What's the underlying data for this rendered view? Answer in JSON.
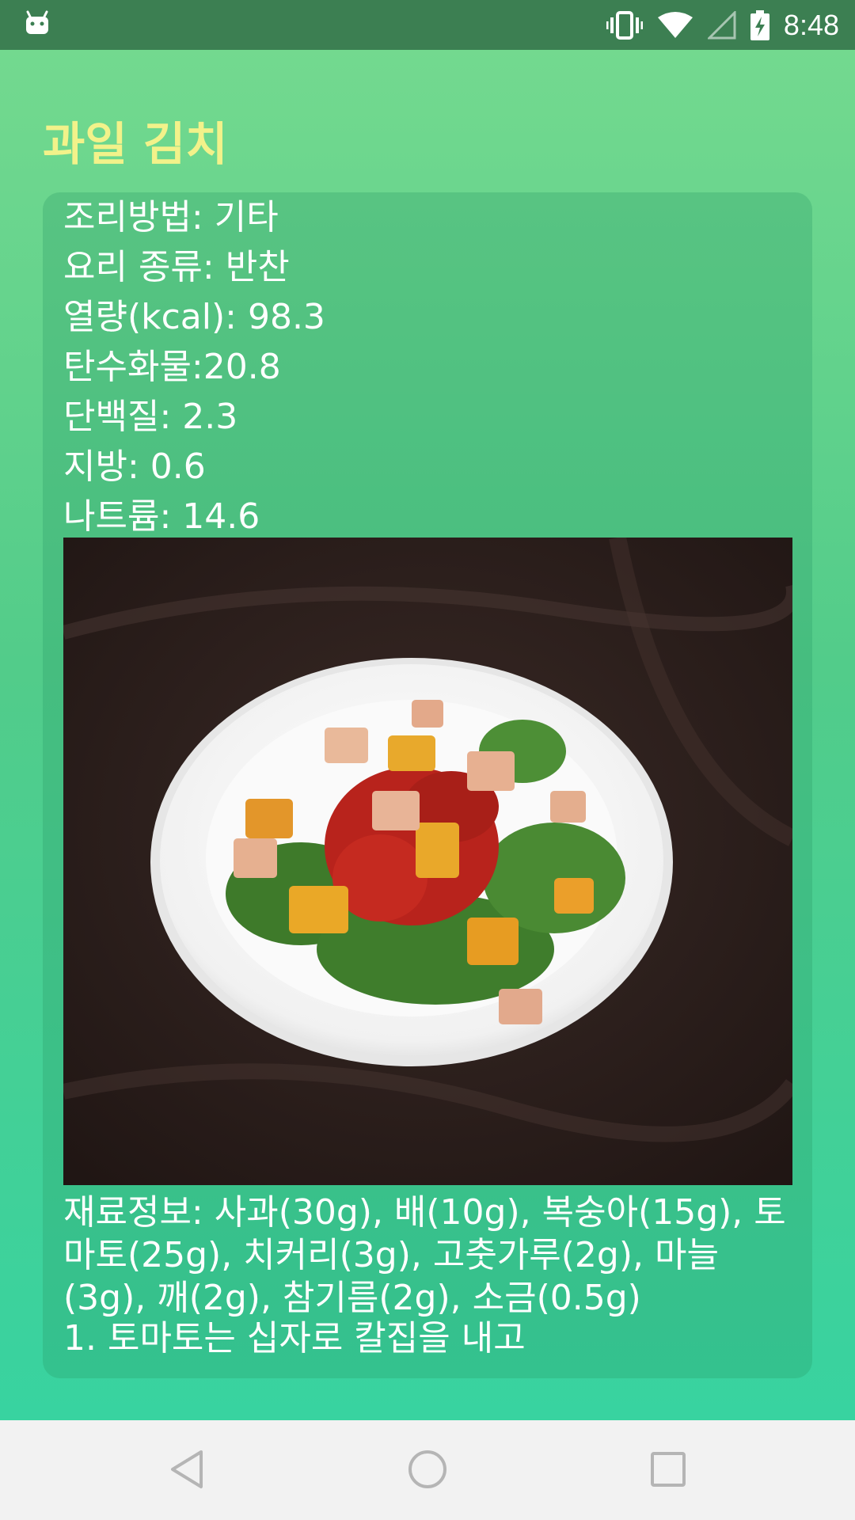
{
  "status_bar": {
    "time": "8:48",
    "icons": [
      "android-icon",
      "vibrate-icon",
      "wifi-icon",
      "signal-icon",
      "battery-charging-icon"
    ]
  },
  "recipe": {
    "title": "과일 김치",
    "info": [
      "조리방법: 기타",
      "요리 종류: 반찬",
      "열량(kcal): 98.3",
      "탄수화물:20.8",
      "단백질: 2.3",
      "지방: 0.6",
      "나트륨: 14.6"
    ],
    "ingredients": "재료정보: 사과(30g), 배(10g), 복숭아(15g), 토마토(25g), 치커리(3g), 고춧가루(2g), 마늘(3g), 깨(2g), 참기름(2g), 소금(0.5g)",
    "steps": [
      "1. 토마토는 십자로 칼집을 내고"
    ]
  },
  "nav_bar": {
    "buttons": [
      "back-icon",
      "home-icon",
      "recents-icon"
    ]
  },
  "colors": {
    "status_bar": "#3c7f52",
    "background_top": "#73d98f",
    "background_bottom": "#38d3a0",
    "title": "#f2f28a"
  }
}
